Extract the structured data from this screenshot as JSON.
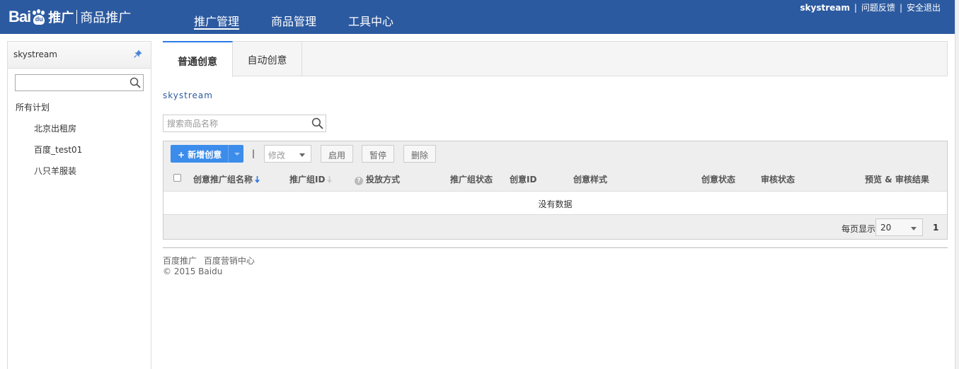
{
  "header": {
    "logo": {
      "bai": "Bai",
      "du": "du",
      "product": "推广",
      "sub": "商品推广"
    },
    "nav": [
      {
        "label": "推广管理",
        "active": true
      },
      {
        "label": "商品管理",
        "active": false
      },
      {
        "label": "工具中心",
        "active": false
      }
    ],
    "top_links": {
      "user": "skystream",
      "feedback": "问题反馈",
      "logout": "安全退出",
      "separator": "|"
    },
    "bg_color": "#2c5aa0"
  },
  "sidebar": {
    "account": "skystream",
    "pin_icon": "pin-icon",
    "search_icon": "search-icon",
    "all_plans": "所有计划",
    "plans": [
      "北京出租房",
      "百度_test01",
      "八只羊服装"
    ]
  },
  "tabs": [
    {
      "label": "普通创意",
      "active": true
    },
    {
      "label": "自动创意",
      "active": false
    }
  ],
  "breadcrumb": "skystream",
  "product_search": {
    "placeholder": "搜索商品名称",
    "icon": "search-icon"
  },
  "toolbar": {
    "new_label": "+ 新增创意",
    "separator": "|",
    "edit_label": "修改",
    "enable_label": "启用",
    "pause_label": "暂停",
    "delete_label": "删除",
    "accent": "#3b8ceb"
  },
  "table": {
    "columns": [
      "创意推广组名称",
      "推广组ID",
      "投放方式",
      "推广组状态",
      "创意ID",
      "创意样式",
      "创意状态",
      "审核状态",
      "预览 & 审核结果"
    ],
    "empty_text": "没有数据"
  },
  "pagination": {
    "label": "每页显示",
    "page_size": "20",
    "current_page": "1"
  },
  "footer": {
    "link1": "百度推广",
    "link2": "百度营销中心",
    "copyright": "© 2015 Baidu"
  }
}
